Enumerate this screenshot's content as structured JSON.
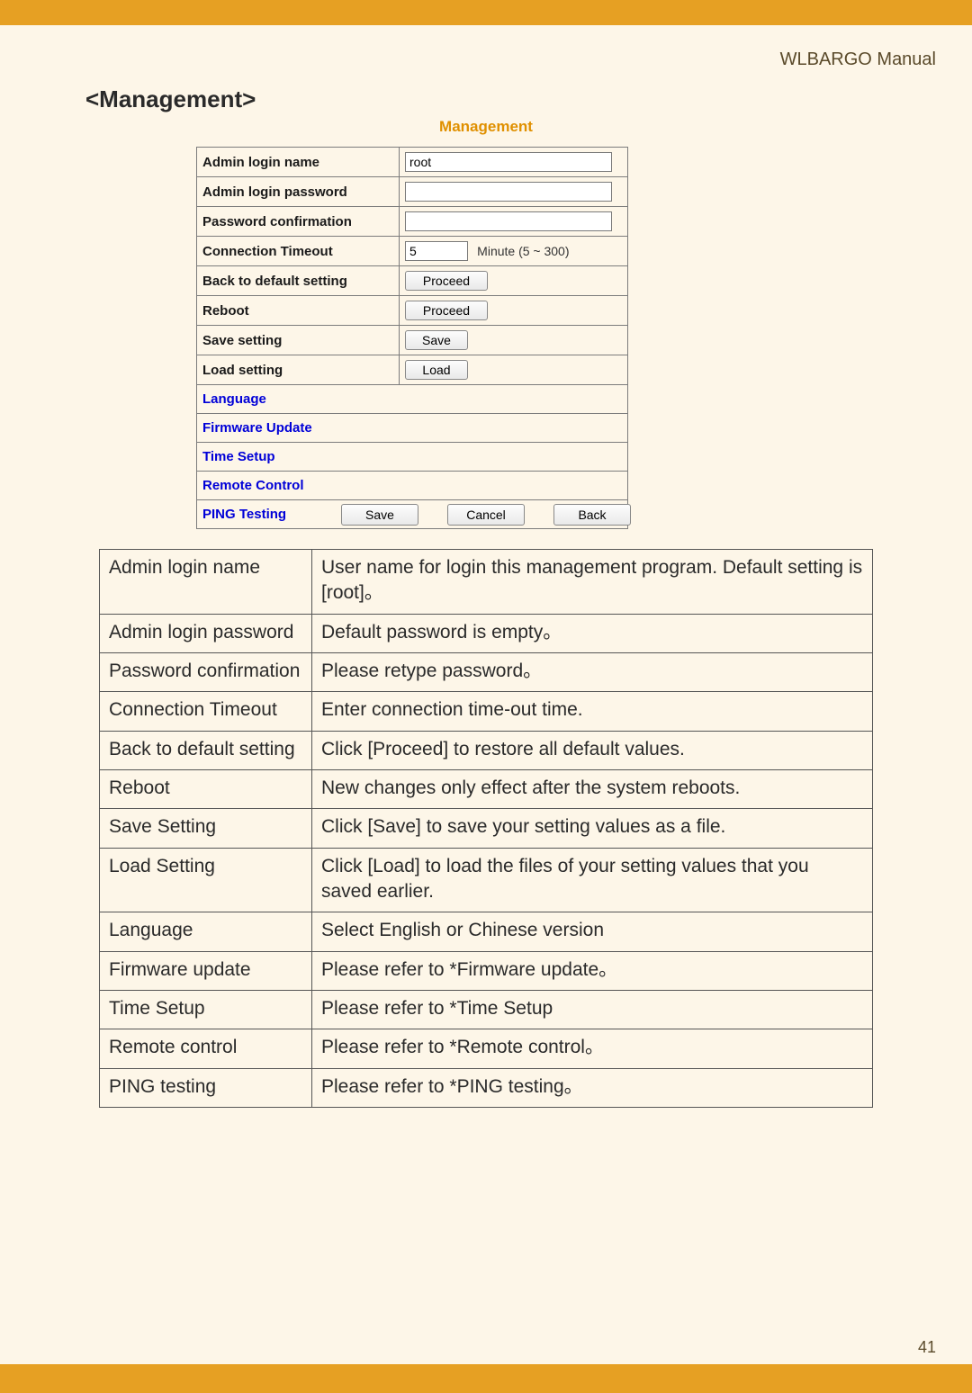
{
  "header": {
    "manual": "WLBARGO Manual"
  },
  "section_title": "<Management>",
  "router": {
    "heading": "Management",
    "rows": {
      "admin_login_name": {
        "label": "Admin login name",
        "value": "root"
      },
      "admin_login_password": {
        "label": "Admin login password",
        "value": ""
      },
      "password_confirmation": {
        "label": "Password confirmation",
        "value": ""
      },
      "connection_timeout": {
        "label": "Connection Timeout",
        "value": "5",
        "note": "Minute (5 ~ 300)"
      },
      "back_default": {
        "label": "Back to default setting",
        "button": "Proceed"
      },
      "reboot": {
        "label": "Reboot",
        "button": "Proceed"
      },
      "save_setting": {
        "label": "Save setting",
        "button": "Save"
      },
      "load_setting": {
        "label": "Load setting",
        "button": "Load"
      }
    },
    "links": {
      "language": "Language",
      "firmware_update": "Firmware Update",
      "time_setup": "Time Setup",
      "remote_control": "Remote Control",
      "ping_testing": "PING Testing"
    },
    "actions": {
      "save": "Save",
      "cancel": "Cancel",
      "back": "Back"
    }
  },
  "desc": {
    "rows": [
      {
        "key": "Admin login name",
        "val": "User name for login this management program. Default setting is [root]。"
      },
      {
        "key": "Admin login password",
        "val": "Default password is empty。"
      },
      {
        "key": "Password confirmation",
        "val": "Please retype password。"
      },
      {
        "key": "Connection Timeout",
        "val": "Enter connection time-out time."
      },
      {
        "key": "Back to default setting",
        "val": "Click [Proceed] to restore all default values."
      },
      {
        "key": "Reboot",
        "val": "New changes only effect after the system reboots."
      },
      {
        "key": "Save Setting",
        "val": "Click [Save] to save your setting values as a file."
      },
      {
        "key": "Load Setting",
        "val": "Click [Load] to load the files of your setting values that you saved earlier."
      },
      {
        "key": "Language",
        "val": "Select English or Chinese version"
      },
      {
        "key": "Firmware update",
        "val": "Please refer to *Firmware update。"
      },
      {
        "key": "Time Setup",
        "val": "Please refer to *Time Setup"
      },
      {
        "key": "Remote control",
        "val": "Please refer to *Remote control。"
      },
      {
        "key": "PING testing",
        "val": "Please refer to *PING testing。"
      }
    ]
  },
  "page_number": "41"
}
